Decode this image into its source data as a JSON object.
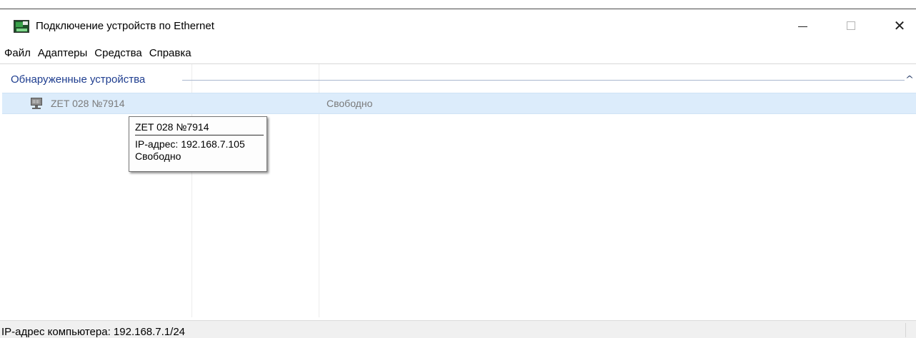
{
  "window": {
    "title": "Подключение устройств по Ethernet",
    "close_glyph": "✕"
  },
  "menu": {
    "items": [
      "Файл",
      "Адаптеры",
      "Средства",
      "Справка"
    ]
  },
  "devices_group": {
    "label": "Обнаруженные устройства",
    "collapse_glyph": "^",
    "rows": [
      {
        "icon": "network-device-icon",
        "name": "ZET 028 №7914",
        "status": "Свободно"
      }
    ]
  },
  "tooltip": {
    "title": "ZET 028 №7914",
    "ip_line": "IP-адрес: 192.168.7.105",
    "status_line": "Свободно"
  },
  "statusbar": {
    "text": "IP-адрес компьютера: 192.168.7.1/24"
  },
  "colors": {
    "accent_text": "#1e3d8f",
    "selection_bg": "#dcecfb"
  }
}
